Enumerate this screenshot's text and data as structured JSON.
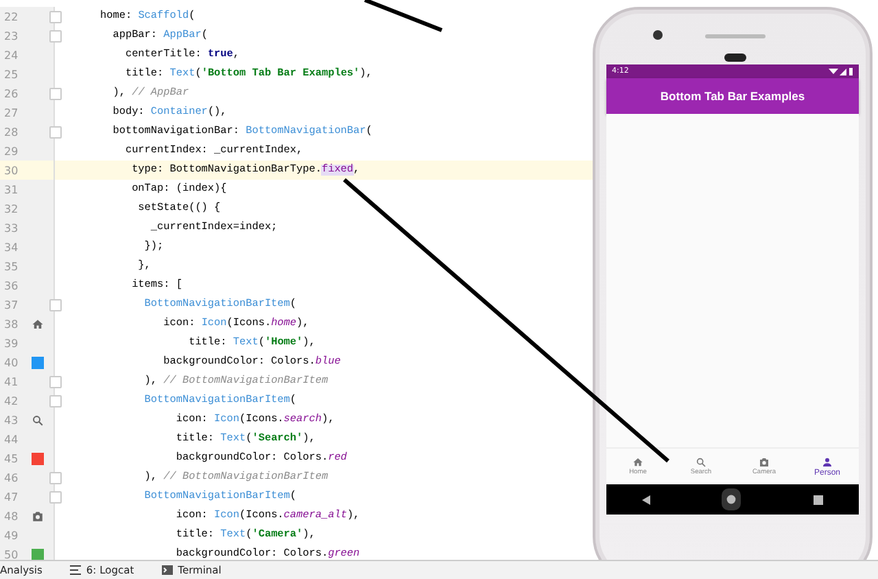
{
  "editor": {
    "lines": [
      {
        "number": "22",
        "fold": true,
        "tokens": [
          {
            "t": "home: ",
            "kind": "plain"
          },
          {
            "t": "Scaffold",
            "kind": "type"
          },
          {
            "t": "(",
            "kind": "plain"
          }
        ]
      },
      {
        "number": "23",
        "fold": true,
        "tokens": [
          {
            "t": "  appBar: ",
            "kind": "plain"
          },
          {
            "t": "AppBar",
            "kind": "type"
          },
          {
            "t": "(",
            "kind": "plain"
          }
        ]
      },
      {
        "number": "24",
        "tokens": [
          {
            "t": "    centerTitle: ",
            "kind": "plain"
          },
          {
            "t": "true",
            "kind": "kw"
          },
          {
            "t": ",",
            "kind": "plain"
          }
        ]
      },
      {
        "number": "25",
        "tokens": [
          {
            "t": "    title: ",
            "kind": "plain"
          },
          {
            "t": "Text",
            "kind": "type"
          },
          {
            "t": "(",
            "kind": "plain"
          },
          {
            "t": "'Bottom Tab Bar Examples'",
            "kind": "str"
          },
          {
            "t": "),",
            "kind": "plain"
          }
        ]
      },
      {
        "number": "26",
        "fold": true,
        "tokens": [
          {
            "t": "  ), ",
            "kind": "plain"
          },
          {
            "t": "// AppBar",
            "kind": "comment"
          }
        ]
      },
      {
        "number": "27",
        "tokens": [
          {
            "t": "  body: ",
            "kind": "plain"
          },
          {
            "t": "Container",
            "kind": "type"
          },
          {
            "t": "(),",
            "kind": "plain"
          }
        ]
      },
      {
        "number": "28",
        "fold": true,
        "tokens": [
          {
            "t": "  bottomNavigationBar: ",
            "kind": "plain"
          },
          {
            "t": "BottomNavigationBar",
            "kind": "type"
          },
          {
            "t": "(",
            "kind": "plain"
          }
        ]
      },
      {
        "number": "29",
        "tokens": [
          {
            "t": "    currentIndex: _currentIndex,",
            "kind": "plain"
          }
        ]
      },
      {
        "number": "30",
        "current": true,
        "tokens": [
          {
            "t": "     type: BottomNavigationBarType.",
            "kind": "plain"
          },
          {
            "t": "fixed",
            "kind": "match"
          },
          {
            "t": ",",
            "kind": "plain"
          }
        ]
      },
      {
        "number": "31",
        "tokens": [
          {
            "t": "     onTap: (index){",
            "kind": "plain"
          }
        ]
      },
      {
        "number": "32",
        "tokens": [
          {
            "t": "      setState(() {",
            "kind": "plain"
          }
        ]
      },
      {
        "number": "33",
        "tokens": [
          {
            "t": "        _currentIndex=index;",
            "kind": "plain"
          }
        ]
      },
      {
        "number": "34",
        "tokens": [
          {
            "t": "       });",
            "kind": "plain"
          }
        ]
      },
      {
        "number": "35",
        "tokens": [
          {
            "t": "      },",
            "kind": "plain"
          }
        ]
      },
      {
        "number": "36",
        "tokens": [
          {
            "t": "     items: [",
            "kind": "plain"
          }
        ]
      },
      {
        "number": "37",
        "fold": true,
        "tokens": [
          {
            "t": "       BottomNavigationBarItem",
            "kind": "type"
          },
          {
            "t": "(",
            "kind": "plain"
          }
        ]
      },
      {
        "number": "38",
        "gutter": {
          "kind": "home"
        },
        "tokens": [
          {
            "t": "          icon: ",
            "kind": "plain"
          },
          {
            "t": "Icon",
            "kind": "type"
          },
          {
            "t": "(Icons.",
            "kind": "plain"
          },
          {
            "t": "home",
            "kind": "const"
          },
          {
            "t": "),",
            "kind": "plain"
          }
        ]
      },
      {
        "number": "39",
        "tokens": [
          {
            "t": "              title: ",
            "kind": "plain"
          },
          {
            "t": "Text",
            "kind": "type"
          },
          {
            "t": "(",
            "kind": "plain"
          },
          {
            "t": "'Home'",
            "kind": "str"
          },
          {
            "t": "),",
            "kind": "plain"
          }
        ]
      },
      {
        "number": "40",
        "gutter": {
          "kind": "swatch",
          "color": "#2196f3"
        },
        "tokens": [
          {
            "t": "          backgroundColor: Colors.",
            "kind": "plain"
          },
          {
            "t": "blue",
            "kind": "const"
          }
        ]
      },
      {
        "number": "41",
        "fold": true,
        "tokens": [
          {
            "t": "       ), ",
            "kind": "plain"
          },
          {
            "t": "// BottomNavigationBarItem",
            "kind": "comment"
          }
        ]
      },
      {
        "number": "42",
        "fold": true,
        "tokens": [
          {
            "t": "       BottomNavigationBarItem",
            "kind": "type"
          },
          {
            "t": "(",
            "kind": "plain"
          }
        ]
      },
      {
        "number": "43",
        "gutter": {
          "kind": "search"
        },
        "tokens": [
          {
            "t": "            icon: ",
            "kind": "plain"
          },
          {
            "t": "Icon",
            "kind": "type"
          },
          {
            "t": "(Icons.",
            "kind": "plain"
          },
          {
            "t": "search",
            "kind": "const"
          },
          {
            "t": "),",
            "kind": "plain"
          }
        ]
      },
      {
        "number": "44",
        "tokens": [
          {
            "t": "            title: ",
            "kind": "plain"
          },
          {
            "t": "Text",
            "kind": "type"
          },
          {
            "t": "(",
            "kind": "plain"
          },
          {
            "t": "'Search'",
            "kind": "str"
          },
          {
            "t": "),",
            "kind": "plain"
          }
        ]
      },
      {
        "number": "45",
        "gutter": {
          "kind": "swatch",
          "color": "#f44336"
        },
        "tokens": [
          {
            "t": "            backgroundColor: Colors.",
            "kind": "plain"
          },
          {
            "t": "red",
            "kind": "const"
          }
        ]
      },
      {
        "number": "46",
        "fold": true,
        "tokens": [
          {
            "t": "       ), ",
            "kind": "plain"
          },
          {
            "t": "// BottomNavigationBarItem",
            "kind": "comment"
          }
        ]
      },
      {
        "number": "47",
        "fold": true,
        "tokens": [
          {
            "t": "       BottomNavigationBarItem",
            "kind": "type"
          },
          {
            "t": "(",
            "kind": "plain"
          }
        ]
      },
      {
        "number": "48",
        "gutter": {
          "kind": "camera"
        },
        "tokens": [
          {
            "t": "            icon: ",
            "kind": "plain"
          },
          {
            "t": "Icon",
            "kind": "type"
          },
          {
            "t": "(Icons.",
            "kind": "plain"
          },
          {
            "t": "camera_alt",
            "kind": "const"
          },
          {
            "t": "),",
            "kind": "plain"
          }
        ]
      },
      {
        "number": "49",
        "tokens": [
          {
            "t": "            title: ",
            "kind": "plain"
          },
          {
            "t": "Text",
            "kind": "type"
          },
          {
            "t": "(",
            "kind": "plain"
          },
          {
            "t": "'Camera'",
            "kind": "str"
          },
          {
            "t": "),",
            "kind": "plain"
          }
        ]
      },
      {
        "number": "50",
        "gutter": {
          "kind": "swatch",
          "color": "#4caf50"
        },
        "tokens": [
          {
            "t": "            backgroundColor: Colors.",
            "kind": "plain"
          },
          {
            "t": "green",
            "kind": "const"
          }
        ]
      }
    ]
  },
  "tool_windows": [
    {
      "label": "Analysis",
      "kind": "plain"
    },
    {
      "label": "6: Logcat",
      "kind": "logcat"
    },
    {
      "label": "Terminal",
      "kind": "terminal"
    }
  ],
  "phone": {
    "status_bar": {
      "time": "4:12"
    },
    "app_bar": {
      "title": "Bottom Tab Bar Examples"
    },
    "bottom_nav": [
      {
        "label": "Home",
        "kind": "home",
        "selected": false
      },
      {
        "label": "Search",
        "kind": "search",
        "selected": false
      },
      {
        "label": "Camera",
        "kind": "camera",
        "selected": false
      },
      {
        "label": "Person",
        "kind": "person",
        "selected": true
      }
    ]
  }
}
